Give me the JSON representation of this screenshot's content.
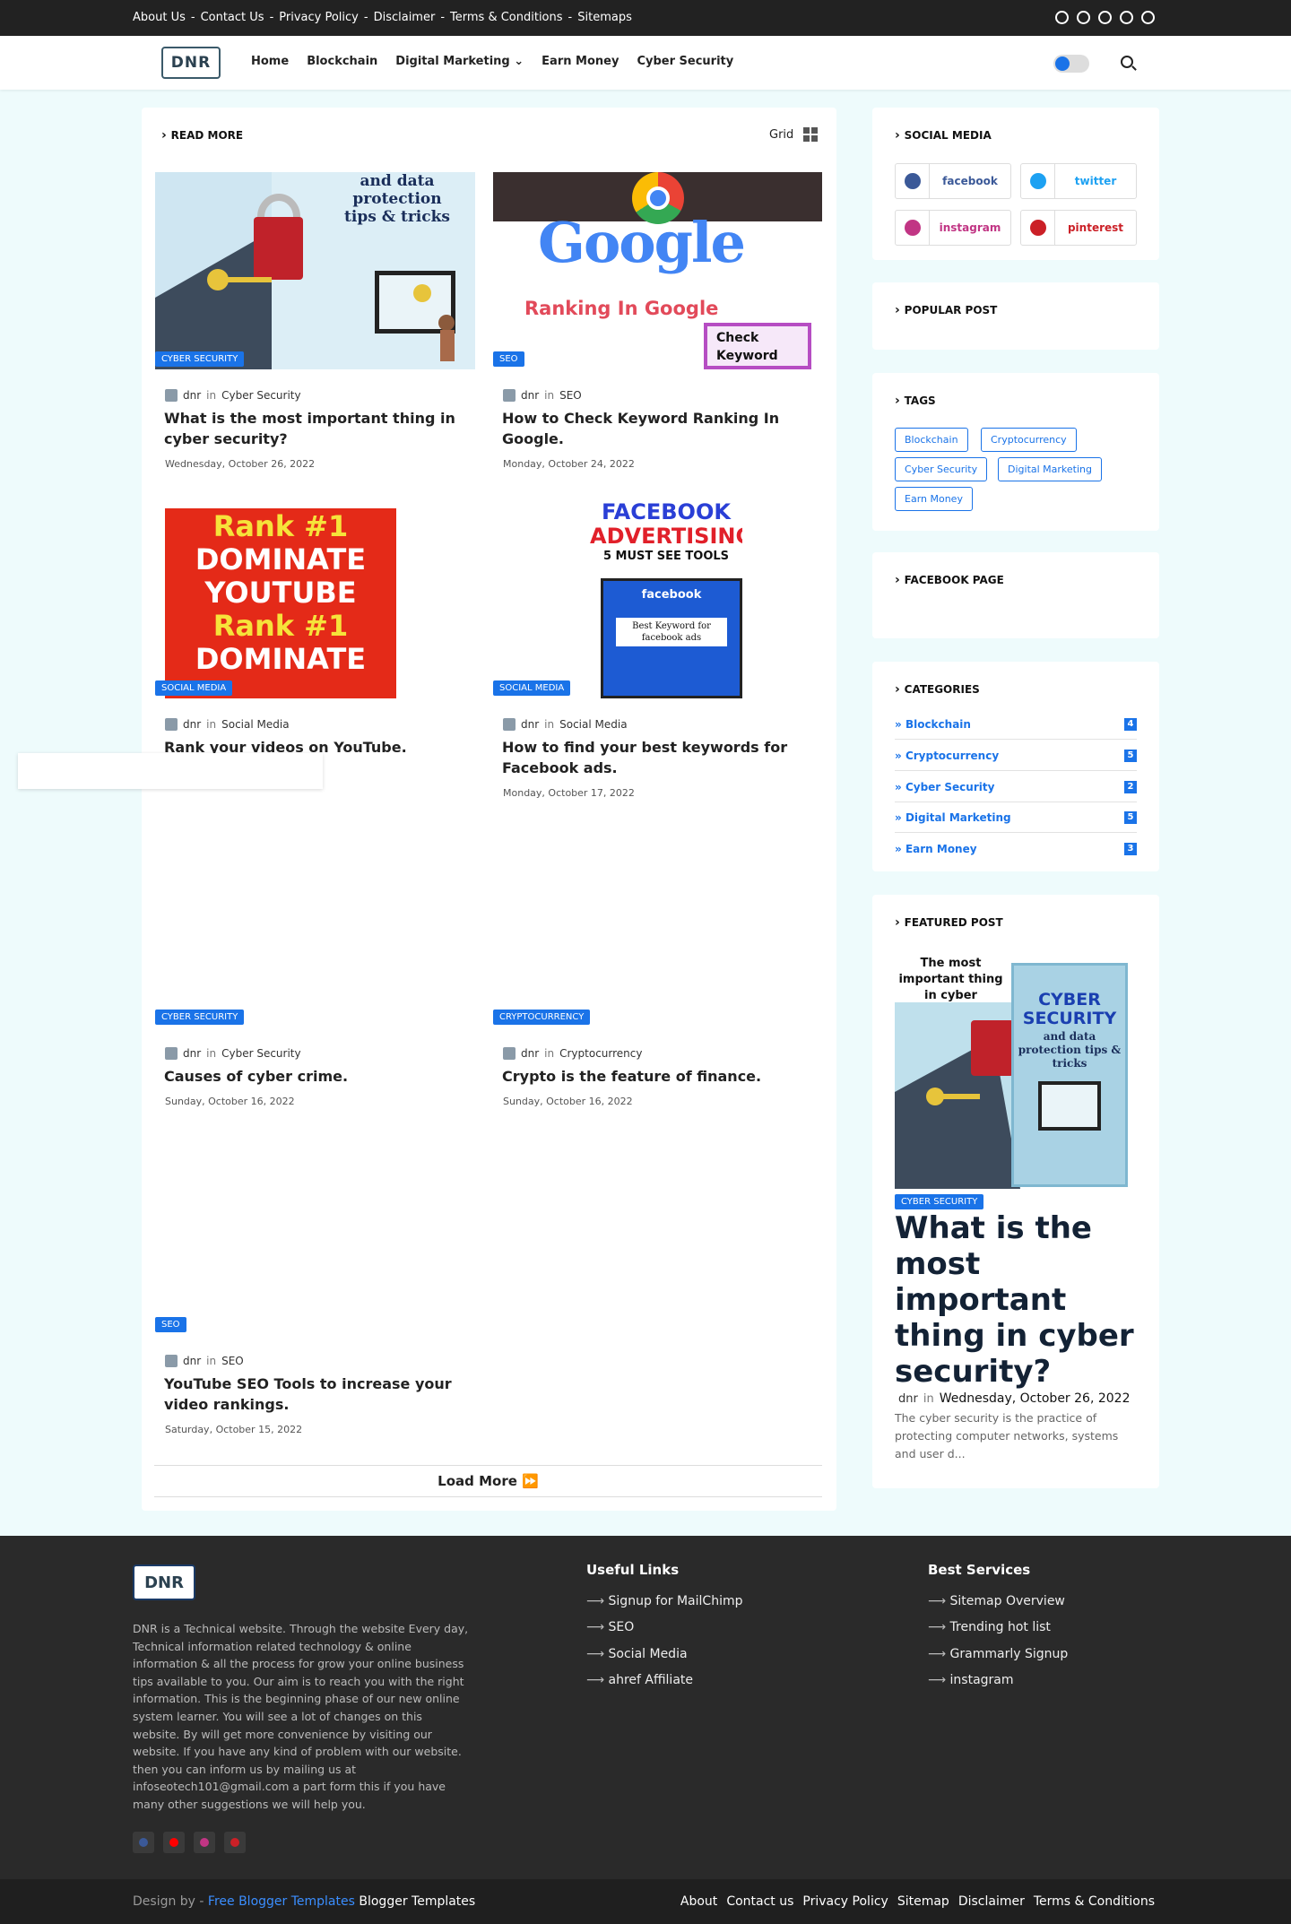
{
  "topbar": {
    "links": [
      "About Us",
      "Contact Us",
      "Privacy Policy",
      "Disclaimer",
      "Terms & Conditions",
      "Sitemaps"
    ],
    "separator": "-",
    "social_icons": [
      "facebook-icon",
      "whatsapp-icon",
      "telegram-icon",
      "instagram-icon",
      "pinterest-icon"
    ]
  },
  "header": {
    "logo_text": "DNR",
    "nav": [
      "Home",
      "Blockchain",
      "Digital Marketing",
      "Earn Money",
      "Cyber Security"
    ],
    "nav_dropdown_index": 2
  },
  "main": {
    "section_title": "READ MORE",
    "view_label": "Grid",
    "posts": [
      {
        "category": "CYBER SECURITY",
        "author": "dnr",
        "in": "in",
        "label": "Cyber Security",
        "title": "What is the most important thing in cyber security?",
        "date": "Wednesday, October 26, 2022"
      },
      {
        "category": "SEO",
        "author": "dnr",
        "in": "in",
        "label": "SEO",
        "title": "How to Check Keyword Ranking In Google.",
        "date": "Monday, October 24, 2022"
      },
      {
        "category": "SOCIAL MEDIA",
        "author": "dnr",
        "in": "in",
        "label": "Social Media",
        "title": "Rank your videos on YouTube.",
        "date": ""
      },
      {
        "category": "SOCIAL MEDIA",
        "author": "dnr",
        "in": "in",
        "label": "Social Media",
        "title": "How to find your best keywords for Facebook ads.",
        "date": "Monday, October 17, 2022"
      },
      {
        "category": "CYBER SECURITY",
        "author": "dnr",
        "in": "in",
        "label": "Cyber Security",
        "title": "Causes of cyber crime.",
        "date": "Sunday, October 16, 2022"
      },
      {
        "category": "CRYPTOCURRENCY",
        "author": "dnr",
        "in": "in",
        "label": "Cryptocurrency",
        "title": "Crypto is the feature of finance.",
        "date": "Sunday, October 16, 2022"
      },
      {
        "category": "SEO",
        "author": "dnr",
        "in": "in",
        "label": "SEO",
        "title": "YouTube SEO Tools to increase your video rankings.",
        "date": "Saturday, October 15, 2022"
      }
    ],
    "images": {
      "cyber": {
        "line1": "and data protection",
        "line2": "tips & tricks"
      },
      "google": {
        "brand": "Google",
        "caption": "Ranking In Google",
        "badge": "Check Keyword"
      },
      "youtube": {
        "line1": "Rank #1",
        "line2": "DOMINATE",
        "line3": "YOUTUBE",
        "line4": "Rank #1",
        "line5": "DOMINATE"
      },
      "facebook": {
        "line1": "FACEBOOK",
        "line2": "ADVERTISING",
        "line3": "5 MUST SEE TOOLS",
        "brand": "facebook",
        "caption": "Best Keyword for facebook ads"
      }
    },
    "load_more": "Load More ⏩"
  },
  "sidebar": {
    "social_title": "SOCIAL MEDIA",
    "social": [
      {
        "label": "facebook",
        "color": "#3b5998"
      },
      {
        "label": "twitter",
        "color": "#1da1f2"
      },
      {
        "label": "instagram",
        "color": "#c13584"
      },
      {
        "label": "pinterest",
        "color": "#cb2027"
      }
    ],
    "popular_title": "POPULAR POST",
    "tags_title": "TAGS",
    "tags": [
      "Blockchain",
      "Cryptocurrency",
      "Cyber Security",
      "Digital Marketing",
      "Earn Money"
    ],
    "facebook_title": "FACEBOOK PAGE",
    "categories_title": "CATEGORIES",
    "categories": [
      {
        "name": "Blockchain",
        "count": "4"
      },
      {
        "name": "Cryptocurrency",
        "count": "5"
      },
      {
        "name": "Cyber Security",
        "count": "2"
      },
      {
        "name": "Digital Marketing",
        "count": "5"
      },
      {
        "name": "Earn Money",
        "count": "3"
      }
    ],
    "featured_title": "FEATURED POST",
    "featured": {
      "image_top": "The most important thing in cyber security?",
      "image_big": "CYBER SECURITY",
      "image_sub": "and data protection tips & tricks",
      "category": "CYBER SECURITY",
      "title": "What is the most important thing in cyber security?",
      "author": "dnr",
      "in": "in",
      "date": "Wednesday, October 26, 2022",
      "excerpt": "The cyber security is the practice of protecting computer networks, systems and user d..."
    }
  },
  "footer": {
    "logo_text": "DNR",
    "description": "DNR is a Technical website. Through the website Every day, Technical information related technology & online information & all the process for grow your online business tips available to you. Our aim is to reach you with the right information. This is the beginning phase of our new online system learner. You will see a lot of changes on this website. By will get more convenience by visiting our website. If you have any kind of problem with our website. then you can inform us by mailing us at infoseotech101@gmail.com a part form this if you have many other suggestions we will help you.",
    "useful_title": "Useful Links",
    "useful_links": [
      "Signup for MailChimp",
      "SEO",
      "Social Media",
      "ahref Affiliate"
    ],
    "services_title": "Best Services",
    "services": [
      "Sitemap Overview",
      "Trending hot list",
      "Grammarly Signup",
      "instagram"
    ],
    "social_colors": [
      "#3b5998",
      "#ff0000",
      "#c13584",
      "#cb2027"
    ],
    "credit_prefix": "Design by -",
    "credit_link": "Free Blogger Templates",
    "credit_suffix": "Blogger Templates",
    "bottom_links": [
      "About",
      "Contact us",
      "Privacy Policy",
      "Sitemap",
      "Disclaimer",
      "Terms & Conditions"
    ]
  }
}
